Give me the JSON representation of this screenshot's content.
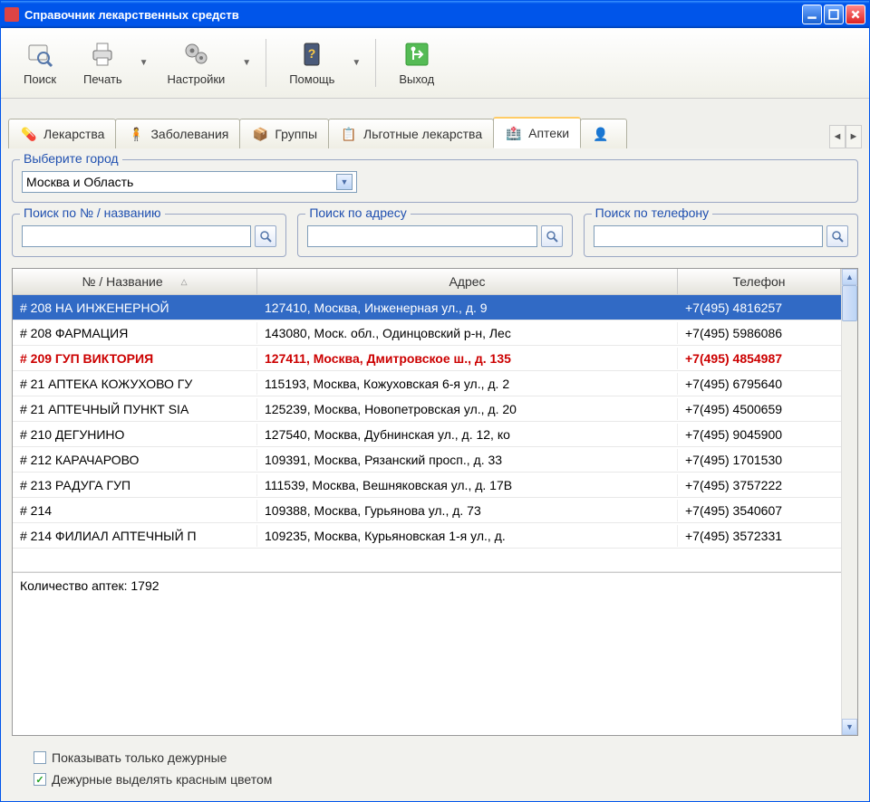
{
  "window": {
    "title": "Справочник лекарственных средств"
  },
  "toolbar": {
    "search": "Поиск",
    "print": "Печать",
    "settings": "Настройки",
    "help": "Помощь",
    "exit": "Выход"
  },
  "tabs": {
    "medicines": "Лекарства",
    "diseases": "Заболевания",
    "groups": "Группы",
    "subsidized": "Льготные лекарства",
    "pharmacies": "Аптеки"
  },
  "city_select": {
    "legend": "Выберите город",
    "value": "Москва и Область"
  },
  "search": {
    "by_name": "Поиск по № / названию",
    "by_address": "Поиск по адресу",
    "by_phone": "Поиск по телефону"
  },
  "table": {
    "columns": {
      "name": "№ / Название",
      "address": "Адрес",
      "phone": "Телефон"
    },
    "rows": [
      {
        "name": "# 208 НА ИНЖЕНЕРНОЙ",
        "address": "127410, Москва, Инженерная ул., д. 9",
        "phone": "+7(495) 4816257",
        "selected": true
      },
      {
        "name": "# 208 ФАРМАЦИЯ",
        "address": "143080, Моск. обл., Одинцовский р-н, Лес",
        "phone": "+7(495) 5986086"
      },
      {
        "name": "# 209 ГУП ВИКТОРИЯ",
        "address": "127411, Москва, Дмитровское ш., д. 135",
        "phone": "+7(495) 4854987",
        "red": true
      },
      {
        "name": "# 21 АПТЕКА КОЖУХОВО ГУ",
        "address": "115193, Москва, Кожуховская 6-я ул., д. 2",
        "phone": "+7(495) 6795640"
      },
      {
        "name": "# 21 АПТЕЧНЫЙ ПУНКТ SIA",
        "address": "125239, Москва, Новопетровская ул., д. 20",
        "phone": "+7(495) 4500659"
      },
      {
        "name": "# 210 ДЕГУНИНО",
        "address": "127540, Москва, Дубнинская ул., д. 12, ко",
        "phone": "+7(495) 9045900"
      },
      {
        "name": "# 212 КАРАЧАРОВО",
        "address": "109391, Москва, Рязанский просп., д. 33",
        "phone": "+7(495) 1701530"
      },
      {
        "name": "# 213 РАДУГА ГУП",
        "address": "111539, Москва, Вешняковская ул., д. 17В",
        "phone": "+7(495) 3757222"
      },
      {
        "name": "# 214",
        "address": "109388, Москва, Гурьянова ул., д. 73",
        "phone": "+7(495) 3540607"
      },
      {
        "name": "# 214 ФИЛИАЛ АПТЕЧНЫЙ П",
        "address": "109235, Москва, Курьяновская 1-я ул., д.",
        "phone": "+7(495) 3572331"
      }
    ],
    "footer": "Количество аптек: 1792"
  },
  "checkboxes": {
    "only_duty": "Показывать только дежурные",
    "highlight_red": "Дежурные выделять красным цветом"
  }
}
